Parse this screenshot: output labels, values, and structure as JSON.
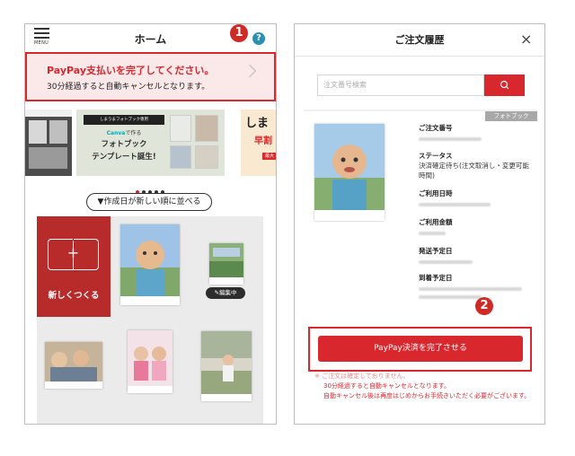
{
  "home": {
    "menu_label": "MENU",
    "title": "ホーム",
    "help_glyph": "?",
    "callout": "1",
    "banner": {
      "line1": "PayPay支払いを完了してください。",
      "line2": "30分経過すると自動キャンセルとなります。"
    },
    "promo": {
      "tag": "しまうまフォトブック専用",
      "canva_brand": "Canva",
      "canva_suffix": "で作る",
      "line1": "フォトブック",
      "line2": "テンプレート誕生!",
      "right_t1": "しま",
      "right_t2": "早割",
      "right_t3": "最大"
    },
    "sort_button": "▼作成日が新しい順に並べる",
    "new_create": "新しくつくる",
    "edit_badge": "編集中"
  },
  "order": {
    "title": "ご注文履歴",
    "close_glyph": "×",
    "search_placeholder": "注文番号検索",
    "category_tag": "フォトブック",
    "labels": {
      "order_no": "ご注文番号",
      "status": "ステータス",
      "use_date": "ご利用日時",
      "amount": "ご利用金額",
      "ship_date": "発送予定日",
      "arrive_date": "到着予定日"
    },
    "status_value": "決済確定待ち(注文取消し・変更可能時間)",
    "callout": "2",
    "pay_button": "PayPay決済を完了させる",
    "notes": {
      "n0": "※ ご注文は確定しておりません。",
      "n1": "30分経過すると自動キャンセルとなります。",
      "n2": "自動キャンセル後は再度はじめからお手続きいただく必要がございます。"
    }
  },
  "colors": {
    "accent_red": "#d9272e",
    "help_blue": "#2a8fb0",
    "new_create_red": "#b82b2b"
  },
  "icons": [
    "hamburger-menu-icon",
    "help-icon",
    "chevron-right-icon",
    "search-icon",
    "close-icon",
    "open-book-plus-icon",
    "pencil-icon"
  ]
}
